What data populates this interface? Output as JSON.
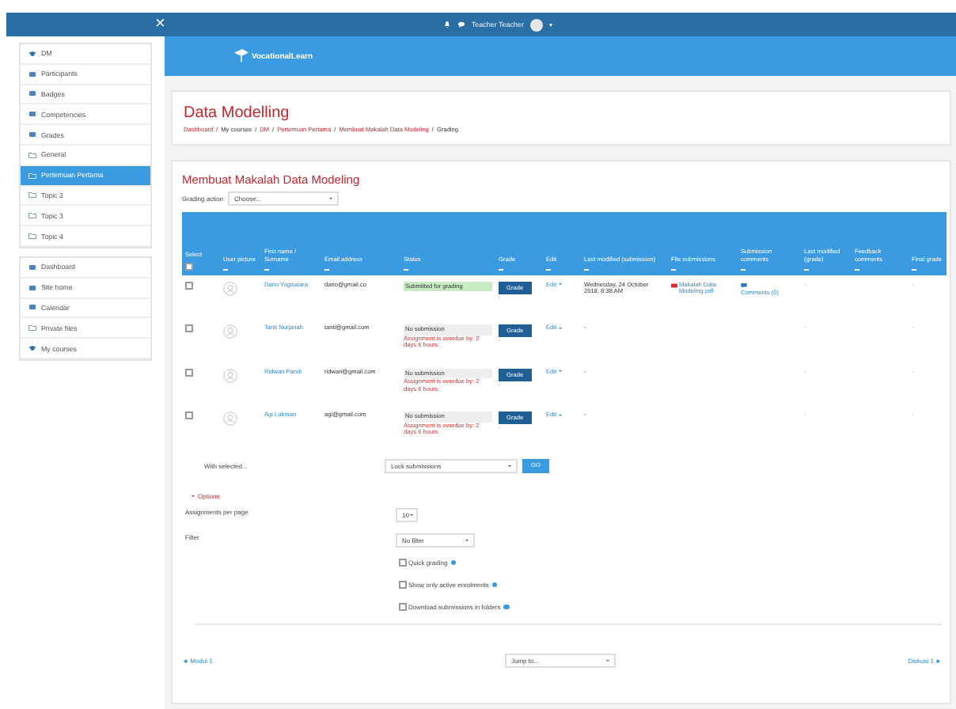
{
  "navbar": {
    "close": "×",
    "user": "Teacher Teacher"
  },
  "sidebar": {
    "course_items": [
      {
        "label": "DM",
        "kind": "course",
        "selected": false
      },
      {
        "label": "Participants",
        "kind": "link",
        "selected": false
      },
      {
        "label": "Badges",
        "kind": "link",
        "selected": false
      },
      {
        "label": "Competencies",
        "kind": "link",
        "selected": false
      },
      {
        "label": "Grades",
        "kind": "link",
        "selected": false
      },
      {
        "label": "General",
        "kind": "section",
        "selected": false
      },
      {
        "label": "Pertemuan Pertama",
        "kind": "section",
        "selected": true
      },
      {
        "label": "Topic 2",
        "kind": "section",
        "selected": false
      },
      {
        "label": "Topic 3",
        "kind": "section",
        "selected": false
      },
      {
        "label": "Topic 4",
        "kind": "section",
        "selected": false
      }
    ],
    "site_items": [
      {
        "label": "Dashboard",
        "kind": "link",
        "selected": false
      },
      {
        "label": "Site home",
        "kind": "link",
        "selected": false
      },
      {
        "label": "Calendar",
        "kind": "link",
        "selected": false
      },
      {
        "label": "Private files",
        "kind": "section",
        "selected": false
      },
      {
        "label": "My courses",
        "kind": "course",
        "selected": false
      }
    ]
  },
  "header": {
    "logo": "VocationalLearn",
    "course_title": "Data Modelling",
    "breadcrumb_separator": "/",
    "breadcrumb": [
      "Dashboard",
      "My courses",
      "DM",
      "Pertemuan Pertama",
      "Membuat Makalah Data Modeling",
      "Grading"
    ]
  },
  "assignment": {
    "title": "Membuat Makalah Data Modeling",
    "grading_action_label": "Grading action",
    "grading_action_value": "Choose...",
    "columns": [
      "Select",
      "User picture",
      "First name / Surname",
      "Email address",
      "Status",
      "Grade",
      "Edit",
      "Last modified (submission)",
      "File submissions",
      "Submission comments",
      "Last modified (grade)",
      "Feedback comments",
      "Final grade"
    ],
    "select_all": {
      "checked": false
    },
    "rows": [
      {
        "checked": false,
        "name": "Dario Yogiswara",
        "email": "dario@gmail.co",
        "status": {
          "kind": "submitted",
          "label": "Submitted for grading"
        },
        "grade_button": "Grade",
        "grade_note": "-",
        "edit": "Edit",
        "last_modified": "Wednesday, 24 October 2018, 8:38 AM",
        "file": "Makalah Data Modeling.pdf",
        "comments": "Comments (0)",
        "last_modified_grade": "-",
        "final_grade": "-"
      },
      {
        "checked": false,
        "name": "Tanti Nurjanah",
        "email": "tanti@gmail.com",
        "status": {
          "kind": "none",
          "label": "No submission"
        },
        "overdue": "Assignment is overdue by: 2 days 6 hours",
        "grade_button": "Grade",
        "grade_note": "-",
        "edit": "Edit",
        "last_modified": "-",
        "last_modified_grade": "-",
        "final_grade": "-"
      },
      {
        "checked": false,
        "name": "Ridwan Pandi",
        "email": "ridwan@gmail.com",
        "status": {
          "kind": "none",
          "label": "No submission"
        },
        "overdue": "Assignment is overdue by: 2 days 6 hours",
        "grade_button": "Grade",
        "grade_note": "-",
        "edit": "Edit",
        "last_modified": "-",
        "last_modified_grade": "-",
        "final_grade": "-"
      },
      {
        "checked": false,
        "name": "Agi Lukman",
        "email": "agi@gmail.com",
        "status": {
          "kind": "none",
          "label": "No submission"
        },
        "overdue": "Assignment is overdue by: 2 days 6 hours",
        "grade_button": "Grade",
        "grade_note": "-",
        "edit": "Edit",
        "last_modified": "-",
        "last_modified_grade": "-",
        "final_grade": "-"
      }
    ],
    "with_selected": {
      "label": "With selected...",
      "value": "Lock submissions",
      "button": "GO"
    },
    "options": {
      "toggle": "Options",
      "expanded": true,
      "per_page_label": "Assignments per page",
      "per_page_value": "10",
      "filter_label": "Filter",
      "filter_value": "No filter",
      "checkboxes": [
        {
          "label": "Quick grading",
          "checked": false
        },
        {
          "label": "Show only active enrolments",
          "checked": false
        },
        {
          "label": "Download submissions in folders",
          "checked": false
        }
      ]
    },
    "footer": {
      "prev": "◄ Modul 1",
      "jump": "Jump to...",
      "next": "Diskusi 1 ►"
    }
  }
}
